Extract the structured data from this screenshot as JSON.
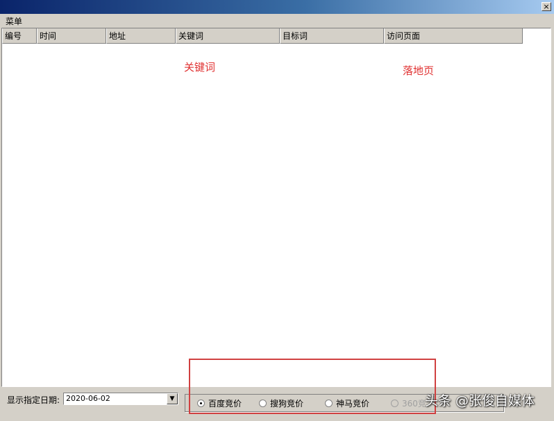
{
  "window": {
    "close_glyph": "×"
  },
  "menu": {
    "label": "菜单"
  },
  "table": {
    "columns": [
      "编号",
      "时间",
      "地址",
      "关键词",
      "目标词",
      "访问页面"
    ]
  },
  "annotations": {
    "keyword": "关键词",
    "landing": "落地页"
  },
  "status": {
    "date_label": "显示指定日期:",
    "date_value": "2020-06-02",
    "dropdown_glyph": "▼",
    "radios": [
      {
        "label": "百度竞价",
        "checked": true,
        "disabled": false
      },
      {
        "label": "搜狗竞价",
        "checked": false,
        "disabled": false
      },
      {
        "label": "神马竞价",
        "checked": false,
        "disabled": false
      },
      {
        "label": "360竞",
        "checked": false,
        "disabled": true
      }
    ]
  },
  "watermark": "头条 @张俊自媒体",
  "colors": {
    "annotation": "#e03030",
    "highlight": "#d04040",
    "title_gradient_start": "#0a246a"
  }
}
